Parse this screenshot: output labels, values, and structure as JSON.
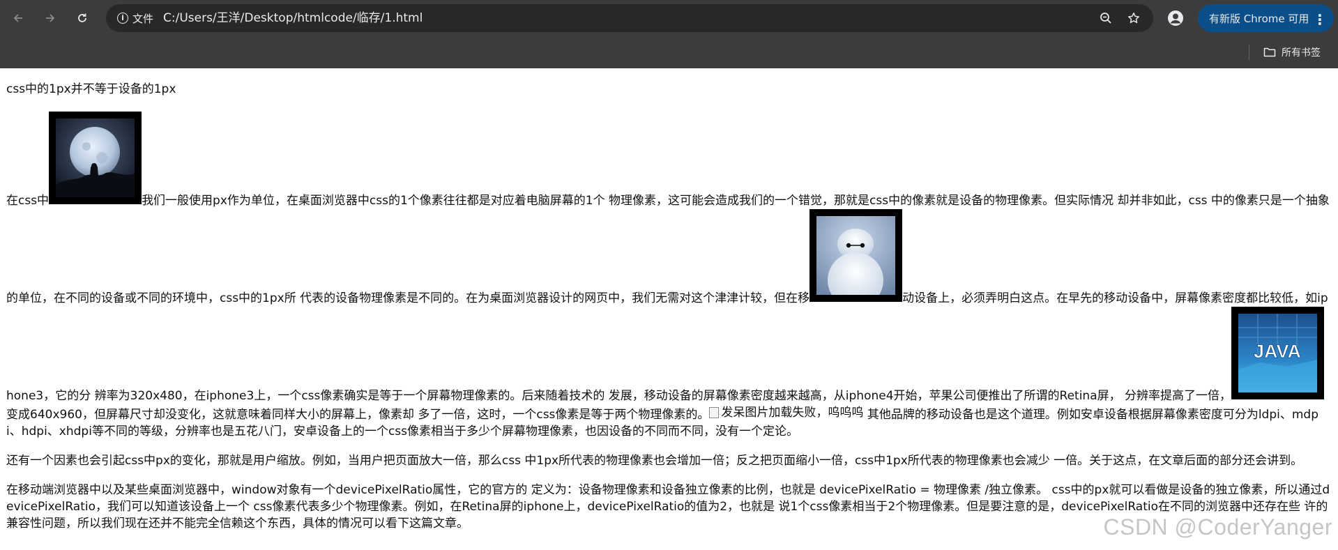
{
  "browser": {
    "site_chip_label": "文件",
    "url": "C:/Users/王洋/Desktop/htmlcode/临存/1.html",
    "update_button_label": "有新版 Chrome 可用",
    "bookmarks_label": "所有书签"
  },
  "article": {
    "heading": "css中的1px并不等于设备的1px",
    "p1_seg1": "在css中",
    "p1_seg2": "我们一般使用px作为单位，在桌面浏览器中css的1个像素往往都是对应着电脑屏幕的1个 物理像素，这可能会造成我们的一个错觉，那就是css中的像素就是设备的物理像素。但实际情况 却并非如此，css 中的像素只是一个抽象的单位，在不同的设备或不同的环境中，css中的1px所 代表的设备物理像素是不同的。在为桌面浏览器设计的网页中，我们无需对这个津津计较，但在移",
    "p1_seg3": "动设备上，必须弄明白这点。在早先的移动设备中，屏幕像素密度都比较低，如iphone3，它的分 辨率为320x480，在iphone3上，一个css像素确实是等于一个屏幕物理像素的。后来随着技术的 发展，移动设备的屏幕像素密度越来越高，从iphone4开始，苹果公司便推出了所谓的Retina屏， 分辨率提高了一倍，",
    "p1_seg4": "变成640x960，但屏幕尺寸却没变化，这就意味着同样大小的屏幕上，像素却 多了一倍，这时，一个css像素是等于两个物理像素的。",
    "broken_image_alt": "发呆图片加载失败，呜呜呜",
    "p1_seg5": " 其他品牌的移动设备也是这个道理。例如安卓设备根据屏幕像素密度可分为ldpi、mdpi、hdpi、xhdpi等不同的等级，分辨率也是五花八门，安卓设备上的一个css像素相当于多少个屏幕物理像素，也因设备的不同而不同，没有一个定论。",
    "p2": "还有一个因素也会引起css中px的变化，那就是用户缩放。例如，当用户把页面放大一倍，那么css 中1px所代表的物理像素也会增加一倍；反之把页面缩小一倍，css中1px所代表的物理像素也会减少 一倍。关于这点，在文章后面的部分还会讲到。",
    "p3": "在移动端浏览器中以及某些桌面浏览器中，window对象有一个devicePixelRatio属性，它的官方的 定义为：设备物理像素和设备独立像素的比例，也就是 devicePixelRatio = 物理像素 /独立像素。 css中的px就可以看做是设备的独立像素，所以通过devicePixelRatio，我们可以知道该设备上一个 css像素代表多少个物理像素。例如，在Retina屏的iphone上，devicePixelRatio的值为2，也就是 说1个css像素相当于2个物理像素。但是要注意的是，devicePixelRatio在不同的浏览器中还存在些 许的兼容性问题，所以我们现在还并不能完全信赖这个东西，具体的情况可以看下这篇文章。"
  },
  "images": {
    "java_label": "JAVA"
  },
  "watermark": "CSDN @CoderYanger"
}
